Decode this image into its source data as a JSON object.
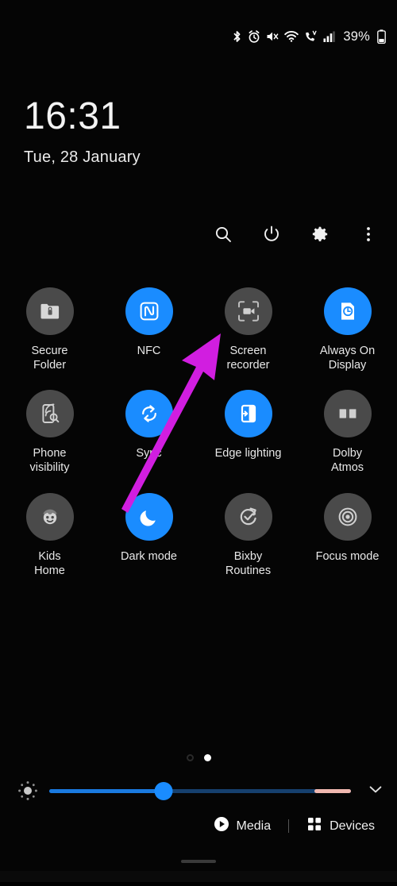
{
  "statusbar": {
    "icons": [
      "bluetooth-icon",
      "alarm-icon",
      "mute-icon",
      "wifi-icon",
      "volte-call-icon",
      "signal-icon"
    ],
    "battery_percent": "39%",
    "battery_icon": "battery-icon"
  },
  "clock": {
    "time": "16:31",
    "date": "Tue, 28 January"
  },
  "toolbar": {
    "search_label": "search-icon",
    "power_label": "power-icon",
    "settings_label": "settings-gear-icon",
    "more_label": "more-options-icon"
  },
  "tiles": [
    {
      "label": "Secure\nFolder",
      "icon": "secure-folder-icon",
      "state": "off"
    },
    {
      "label": "NFC",
      "icon": "nfc-icon",
      "state": "on"
    },
    {
      "label": "Screen\nrecorder",
      "icon": "screen-recorder-icon",
      "state": "off"
    },
    {
      "label": "Always On\nDisplay",
      "icon": "always-on-display-icon",
      "state": "on"
    },
    {
      "label": "Phone\nvisibility",
      "icon": "phone-visibility-icon",
      "state": "off"
    },
    {
      "label": "Sync",
      "icon": "sync-icon",
      "state": "on"
    },
    {
      "label": "Edge lighting",
      "icon": "edge-lighting-icon",
      "state": "on"
    },
    {
      "label": "Dolby\nAtmos",
      "icon": "dolby-atmos-icon",
      "state": "off"
    },
    {
      "label": "Kids\nHome",
      "icon": "kids-home-icon",
      "state": "off"
    },
    {
      "label": "Dark mode",
      "icon": "dark-mode-icon",
      "state": "on"
    },
    {
      "label": "Bixby\nRoutines",
      "icon": "bixby-routines-icon",
      "state": "off"
    },
    {
      "label": "Focus mode",
      "icon": "focus-mode-icon",
      "state": "off"
    }
  ],
  "pager": {
    "total_pages": 2,
    "active_page": 2
  },
  "brightness": {
    "icon": "brightness-icon",
    "value_percent": 38,
    "expand_icon": "chevron-down-icon"
  },
  "footer": {
    "media_label": "Media",
    "media_icon": "play-circle-icon",
    "devices_label": "Devices",
    "devices_icon": "devices-grid-icon"
  },
  "annotation": {
    "arrow_color": "#d11ee0",
    "points_to": "Screen recorder"
  },
  "colors": {
    "accent_on": "#1a8cff",
    "tile_off": "#4a4a4a",
    "background": "#050505",
    "slider_fill": "#1a7ae0",
    "slider_end": "#f0b8b0"
  }
}
